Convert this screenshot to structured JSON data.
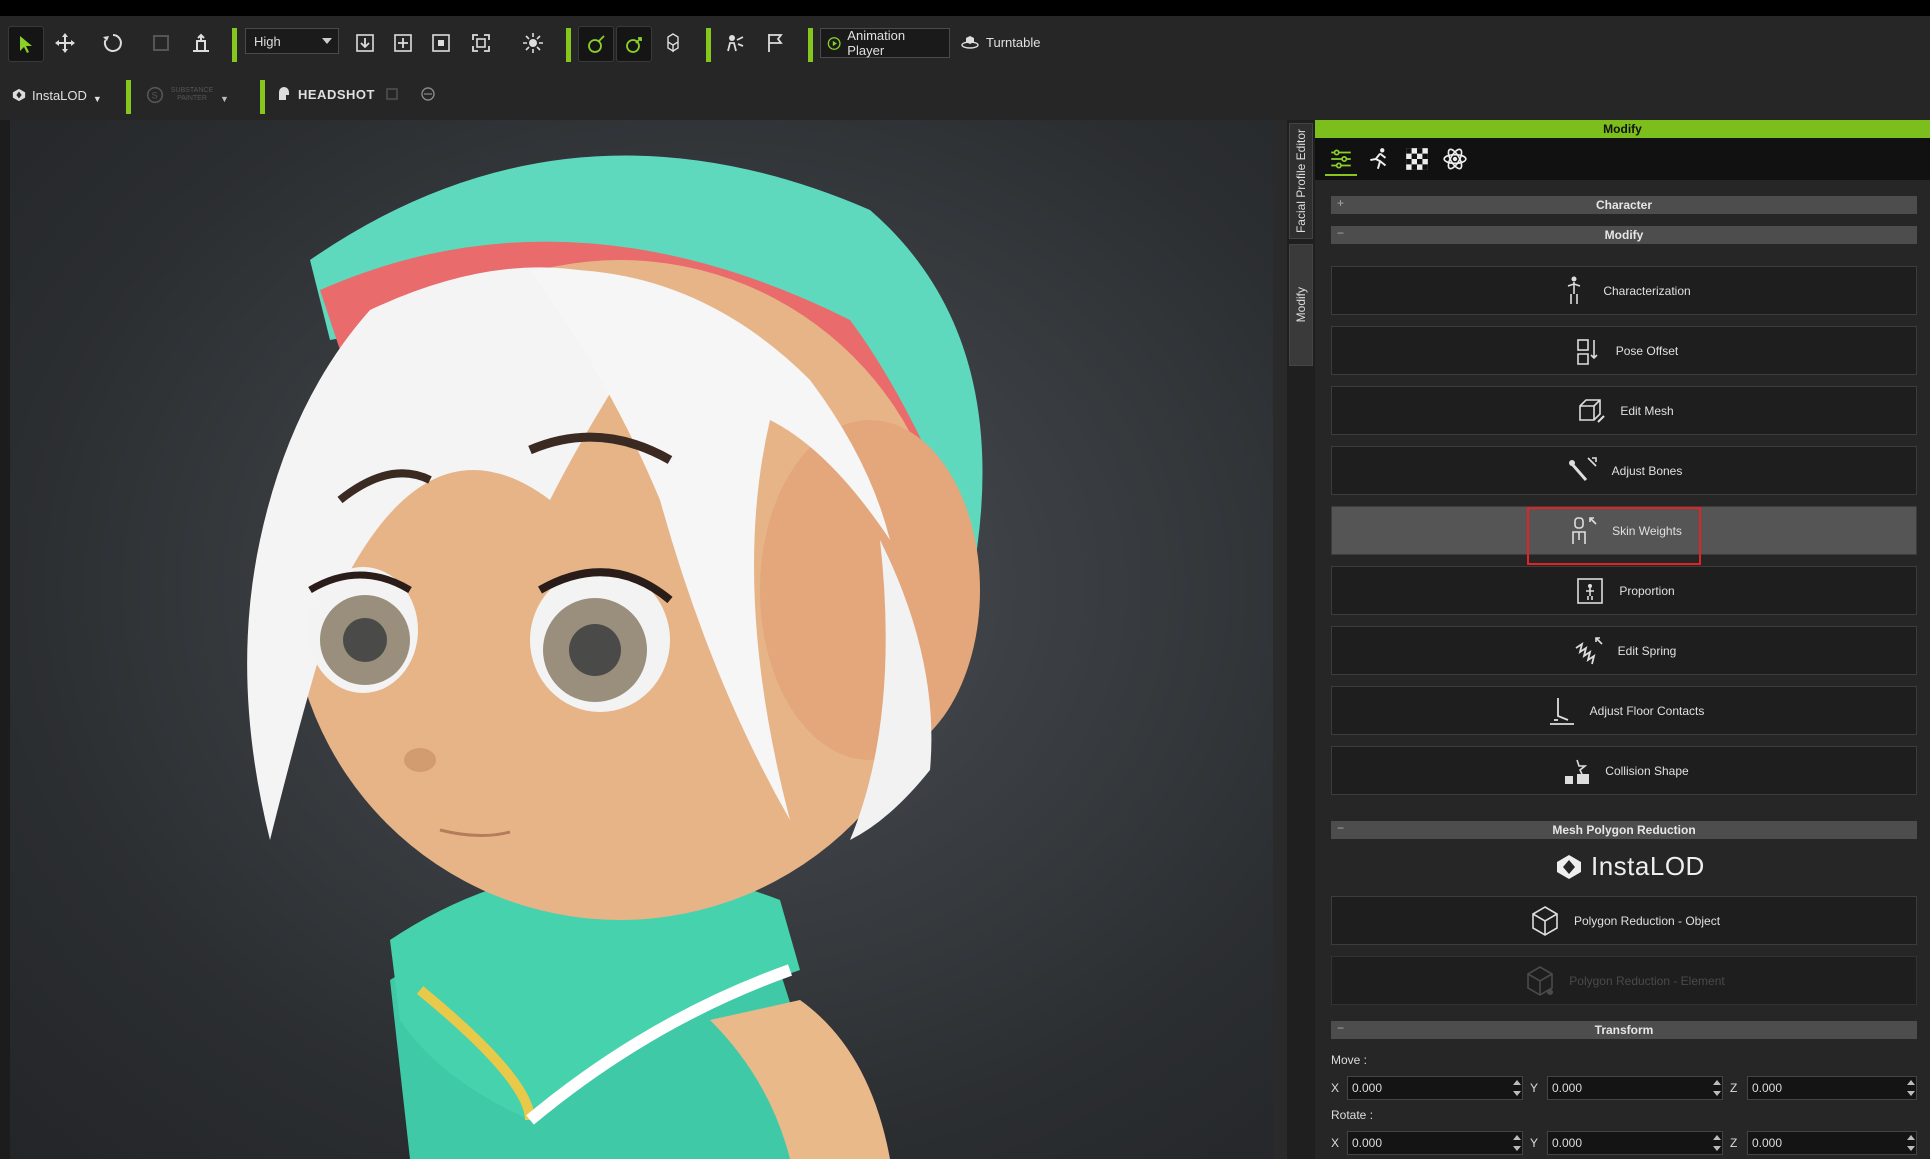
{
  "toolbar": {
    "quality_value": "High",
    "animation_player_label": "Animation Player",
    "turntable_label": "Turntable",
    "instalod_label": "InstaLOD",
    "substance_label": "SUBSTANCE PAINTER",
    "headshot_label": "HEADSHOT"
  },
  "side_tabs": {
    "facial": "Facial Profile Editor",
    "modify": "Modify"
  },
  "panel": {
    "title": "Modify",
    "sections": {
      "character": "Character",
      "modify": "Modify",
      "mesh_reduction": "Mesh Polygon Reduction",
      "transform": "Transform"
    },
    "signs": {
      "plus": "+",
      "minus": "−"
    },
    "buttons": {
      "characterization": "Characterization",
      "pose_offset": "Pose Offset",
      "edit_mesh": "Edit Mesh",
      "adjust_bones": "Adjust Bones",
      "skin_weights": "Skin Weights",
      "proportion": "Proportion",
      "edit_spring": "Edit Spring",
      "adjust_floor": "Adjust Floor Contacts",
      "collision_shape": "Collision Shape",
      "poly_object": "Polygon Reduction - Object",
      "poly_element": "Polygon Reduction - Element"
    },
    "instalod_logo": "InstaLOD",
    "transform": {
      "move_label": "Move :",
      "rotate_label": "Rotate :",
      "axes": {
        "x": "X",
        "y": "Y",
        "z": "Z"
      },
      "move": {
        "x": "0.000",
        "y": "0.000",
        "z": "0.000"
      },
      "rotate": {
        "x": "0.000",
        "y": "0.000",
        "z": "0.000"
      }
    }
  },
  "colors": {
    "accent_green": "#86c71e",
    "highlight_red": "#e02424",
    "panel_bg": "#262626"
  }
}
